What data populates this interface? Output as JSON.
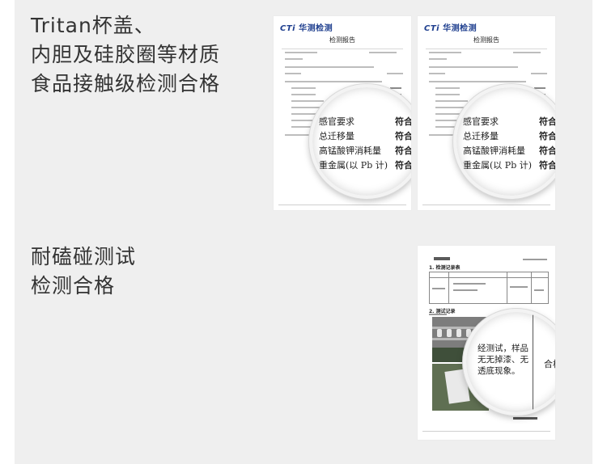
{
  "section1": {
    "headline_lines": [
      "Tritan杯盖、",
      "内胆及硅胶圈等材质",
      "食品接触级检测合格"
    ],
    "report_left": {
      "brand_logo": "CTi",
      "brand_name": "华测检测",
      "report_title": "检测报告",
      "magnified_rows": [
        {
          "item": "感官要求",
          "result": "符合"
        },
        {
          "item": "总迁移量",
          "result": "符合"
        },
        {
          "item": "高锰酸钾消耗量",
          "result": "符合"
        },
        {
          "item": "重金属(以 Pb 计)",
          "result": "符合"
        }
      ]
    },
    "report_right": {
      "brand_logo": "CTi",
      "brand_name": "华测检测",
      "report_title": "检测报告",
      "magnified_rows": [
        {
          "item": "感官要求",
          "result": "符合"
        },
        {
          "item": "总迁移量",
          "result": "符合"
        },
        {
          "item": "高锰酸钾消耗量",
          "result": "符合"
        },
        {
          "item": "重金属(以 Pb 计)",
          "result": "符合"
        }
      ]
    }
  },
  "section2": {
    "headline_lines": [
      "耐磕碰测试",
      "检测合格"
    ],
    "test_report": {
      "section_1_title": "1. 检测记录表",
      "section_2_title": "2. 测试记录",
      "magnified_text": "经测试，样品无无掉漆、无透底现象。",
      "magnified_result": "合格"
    }
  }
}
